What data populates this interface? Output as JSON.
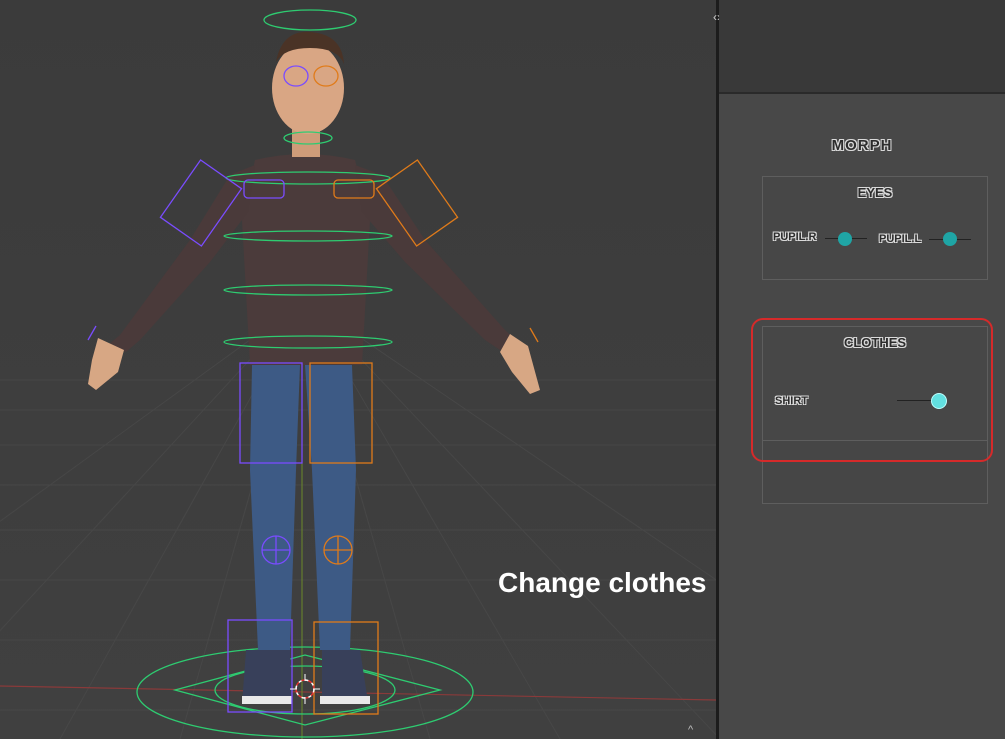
{
  "panel": {
    "title": "MORPH",
    "eyes_group": {
      "title": "EYES",
      "sliders": [
        {
          "label": "PUPIL.R",
          "value": 0.5
        },
        {
          "label": "PUPIL.L",
          "value": 0.5
        }
      ]
    },
    "clothes_group": {
      "title": "CLOTHES",
      "sliders": [
        {
          "label": "SHIRT",
          "value": 0.85
        }
      ]
    }
  },
  "caption": "Change clothes",
  "colors": {
    "viewport_bg": "#3b3b3b",
    "sidebar_bg": "#484848",
    "knob_teal": "#1fa5a5",
    "knob_active": "#62e0e0",
    "highlight": "#d62a2a",
    "rig_green": "#2ecc71",
    "rig_purple": "#7a4cff",
    "rig_orange": "#e07b1a"
  },
  "icons": {
    "split": "split-arrows-icon",
    "corner": "chevron-up-icon"
  }
}
